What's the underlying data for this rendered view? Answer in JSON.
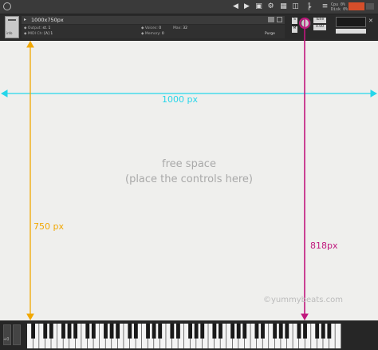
{
  "toolbar": {
    "icons": [
      "kontakt-logo-icon",
      "prev-icon",
      "next-icon",
      "save-icon",
      "settings-icon",
      "browser-icon",
      "view-icon",
      "midi-icon",
      "output-icon"
    ],
    "meters": {
      "left_lines": [
        "0",
        "0"
      ],
      "cpu_label": "Cpu",
      "cpu_value": "0%",
      "disk_label": "Disk",
      "disk_value": "0%"
    }
  },
  "instrument": {
    "name": "1000x750px",
    "output_label": "Output:",
    "output_value": "st. 1",
    "voices_label": "Voices:",
    "voices_value": "0",
    "max_label": "Max:",
    "max_value": "32",
    "midi_label": "MIDI Ch:",
    "midi_value": "[A] 1",
    "memory_label": "Memory:",
    "memory_value": "0",
    "purge_label": "Purge",
    "thumb_label": "info",
    "s_label": "S",
    "m_label": "M",
    "tune_label": "Tune",
    "tune_value": "0.00"
  },
  "canvas": {
    "free_line1": "free space",
    "free_line2": "(place the controls here)",
    "label_width": "1000 px",
    "label_height": "750 px",
    "label_total": "818px",
    "watermark": "©yummybeats.com",
    "colors": {
      "width_arrow": "#26d6ea",
      "height_arrow": "#f1a700",
      "total_arrow": "#c0177d"
    }
  },
  "keyboard": {
    "octave_label": "+0"
  }
}
